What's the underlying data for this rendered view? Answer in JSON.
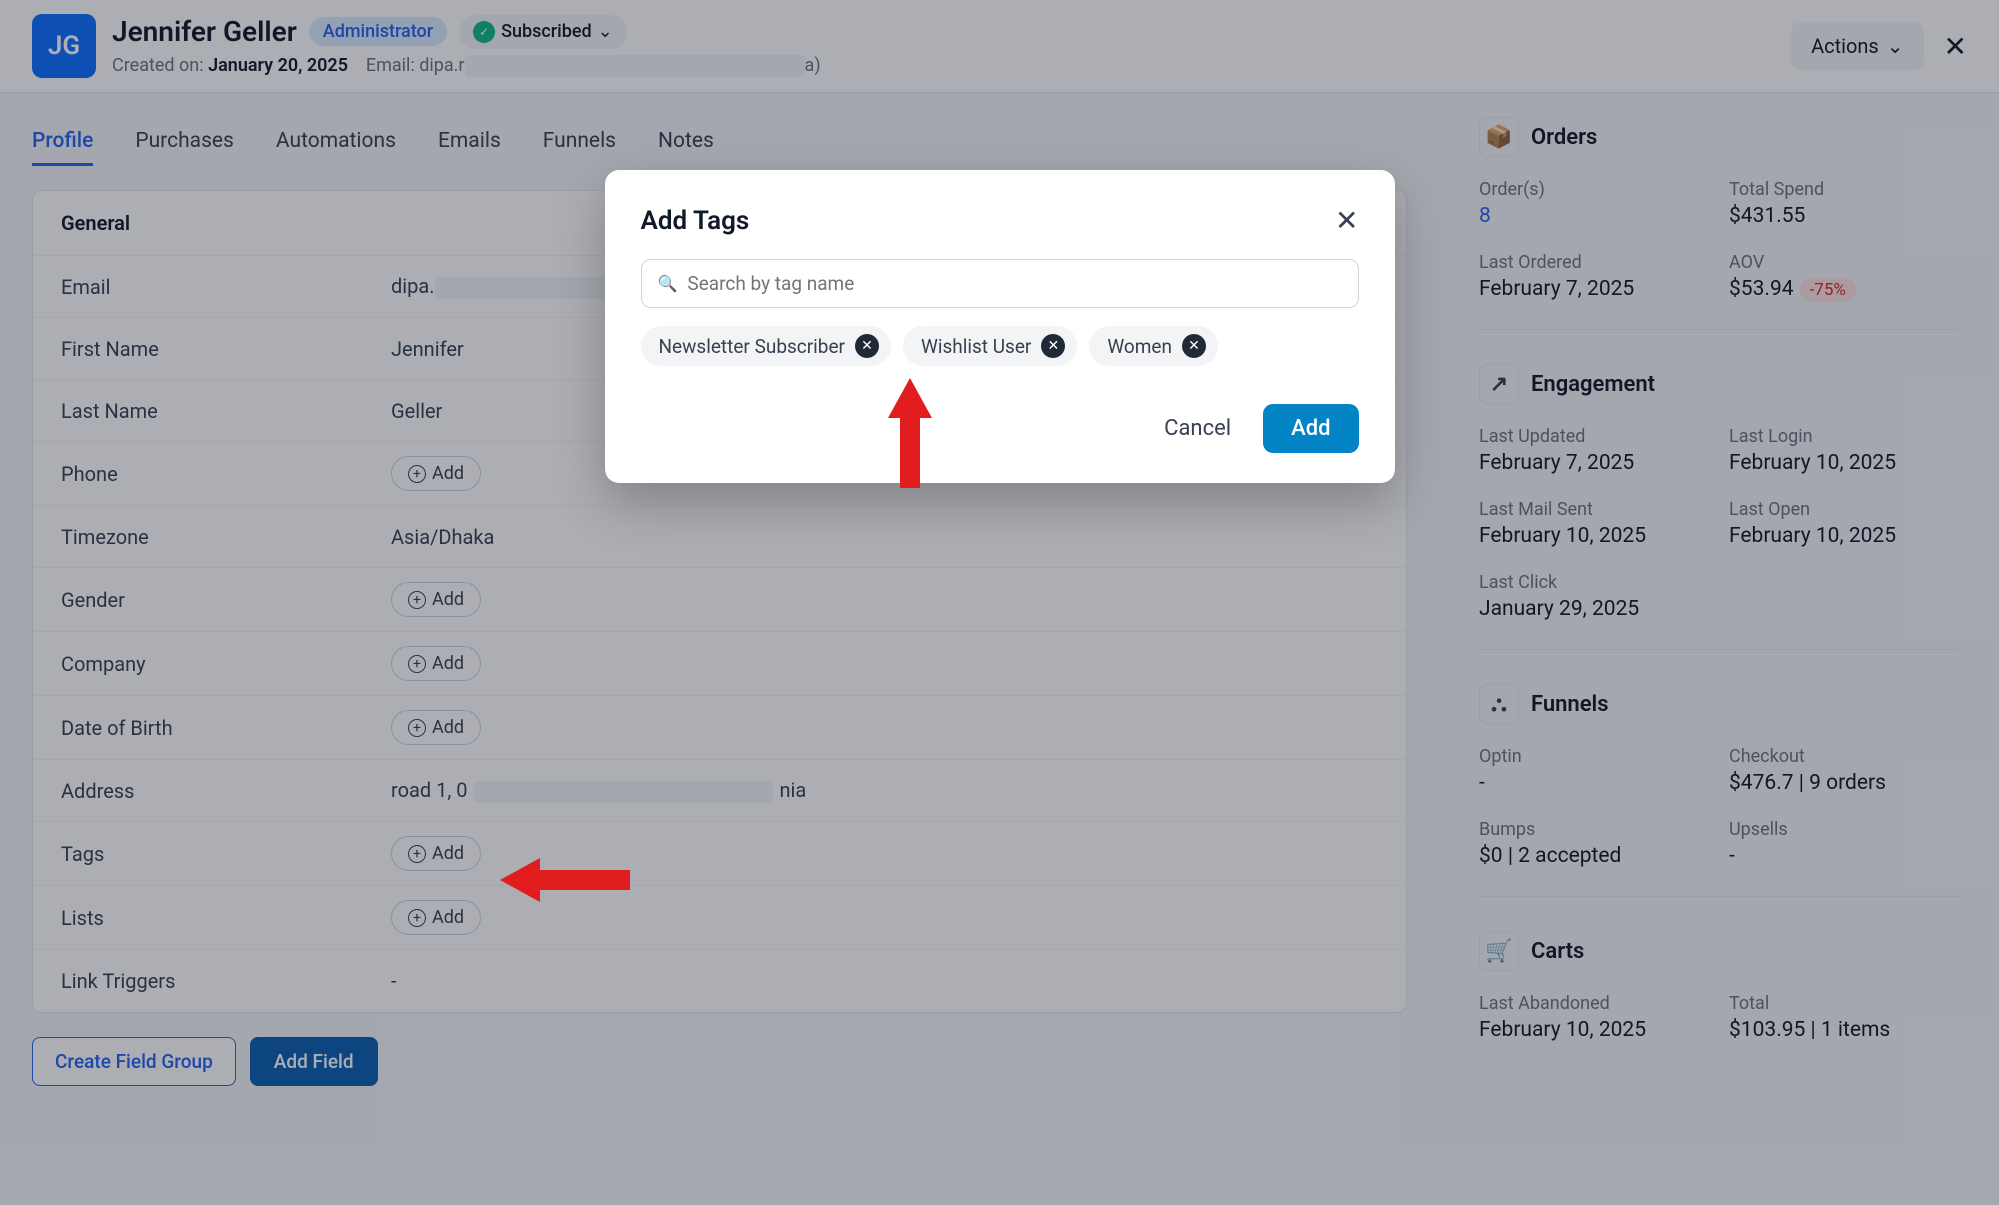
{
  "header": {
    "initials": "JG",
    "name": "Jennifer Geller",
    "role": "Administrator",
    "subscribed_label": "Subscribed",
    "created_label": "Created on:",
    "created_value": "January 20, 2025",
    "email_label": "Email:",
    "email_value_prefix": "dipa.r",
    "email_value_suffix": "a)",
    "actions_label": "Actions"
  },
  "tabs": [
    "Profile",
    "Purchases",
    "Automations",
    "Emails",
    "Funnels",
    "Notes"
  ],
  "general": {
    "title": "General",
    "rows": {
      "email": {
        "label": "Email",
        "val": "dipa."
      },
      "first_name": {
        "label": "First Name",
        "val": "Jennifer"
      },
      "last_name": {
        "label": "Last Name",
        "val": "Geller"
      },
      "phone": {
        "label": "Phone",
        "add": "Add"
      },
      "timezone": {
        "label": "Timezone",
        "val": "Asia/Dhaka"
      },
      "gender": {
        "label": "Gender",
        "add": "Add"
      },
      "company": {
        "label": "Company",
        "add": "Add"
      },
      "dob": {
        "label": "Date of Birth",
        "add": "Add"
      },
      "address": {
        "label": "Address",
        "prefix": "road 1, 0",
        "suffix": "nia"
      },
      "tags": {
        "label": "Tags",
        "add": "Add"
      },
      "lists": {
        "label": "Lists",
        "add": "Add"
      },
      "link_triggers": {
        "label": "Link Triggers",
        "val": "-"
      }
    }
  },
  "bottom": {
    "create_group": "Create Field Group",
    "add_field": "Add Field"
  },
  "sidebar": {
    "orders": {
      "title": "Orders",
      "count_label": "Order(s)",
      "count": "8",
      "spend_label": "Total Spend",
      "spend": "$431.55",
      "last_ordered_label": "Last Ordered",
      "last_ordered": "February 7, 2025",
      "aov_label": "AOV",
      "aov": "$53.94",
      "aov_pct": "-75%"
    },
    "engagement": {
      "title": "Engagement",
      "last_updated_label": "Last Updated",
      "last_updated": "February 7, 2025",
      "last_login_label": "Last Login",
      "last_login": "February 10, 2025",
      "last_mail_label": "Last Mail Sent",
      "last_mail": "February 10, 2025",
      "last_open_label": "Last Open",
      "last_open": "February 10, 2025",
      "last_click_label": "Last Click",
      "last_click": "January 29, 2025"
    },
    "funnels": {
      "title": "Funnels",
      "optin_label": "Optin",
      "optin": "-",
      "checkout_label": "Checkout",
      "checkout": "$476.7 | 9 orders",
      "bumps_label": "Bumps",
      "bumps": "$0 | 2 accepted",
      "upsells_label": "Upsells",
      "upsells": "-"
    },
    "carts": {
      "title": "Carts",
      "abandoned_label": "Last Abandoned",
      "abandoned": "February 10, 2025",
      "total_label": "Total",
      "total": "$103.95 | 1 items"
    }
  },
  "modal": {
    "title": "Add Tags",
    "search_placeholder": "Search by tag name",
    "tags": [
      "Newsletter Subscriber",
      "Wishlist User",
      "Women"
    ],
    "cancel": "Cancel",
    "add": "Add"
  }
}
